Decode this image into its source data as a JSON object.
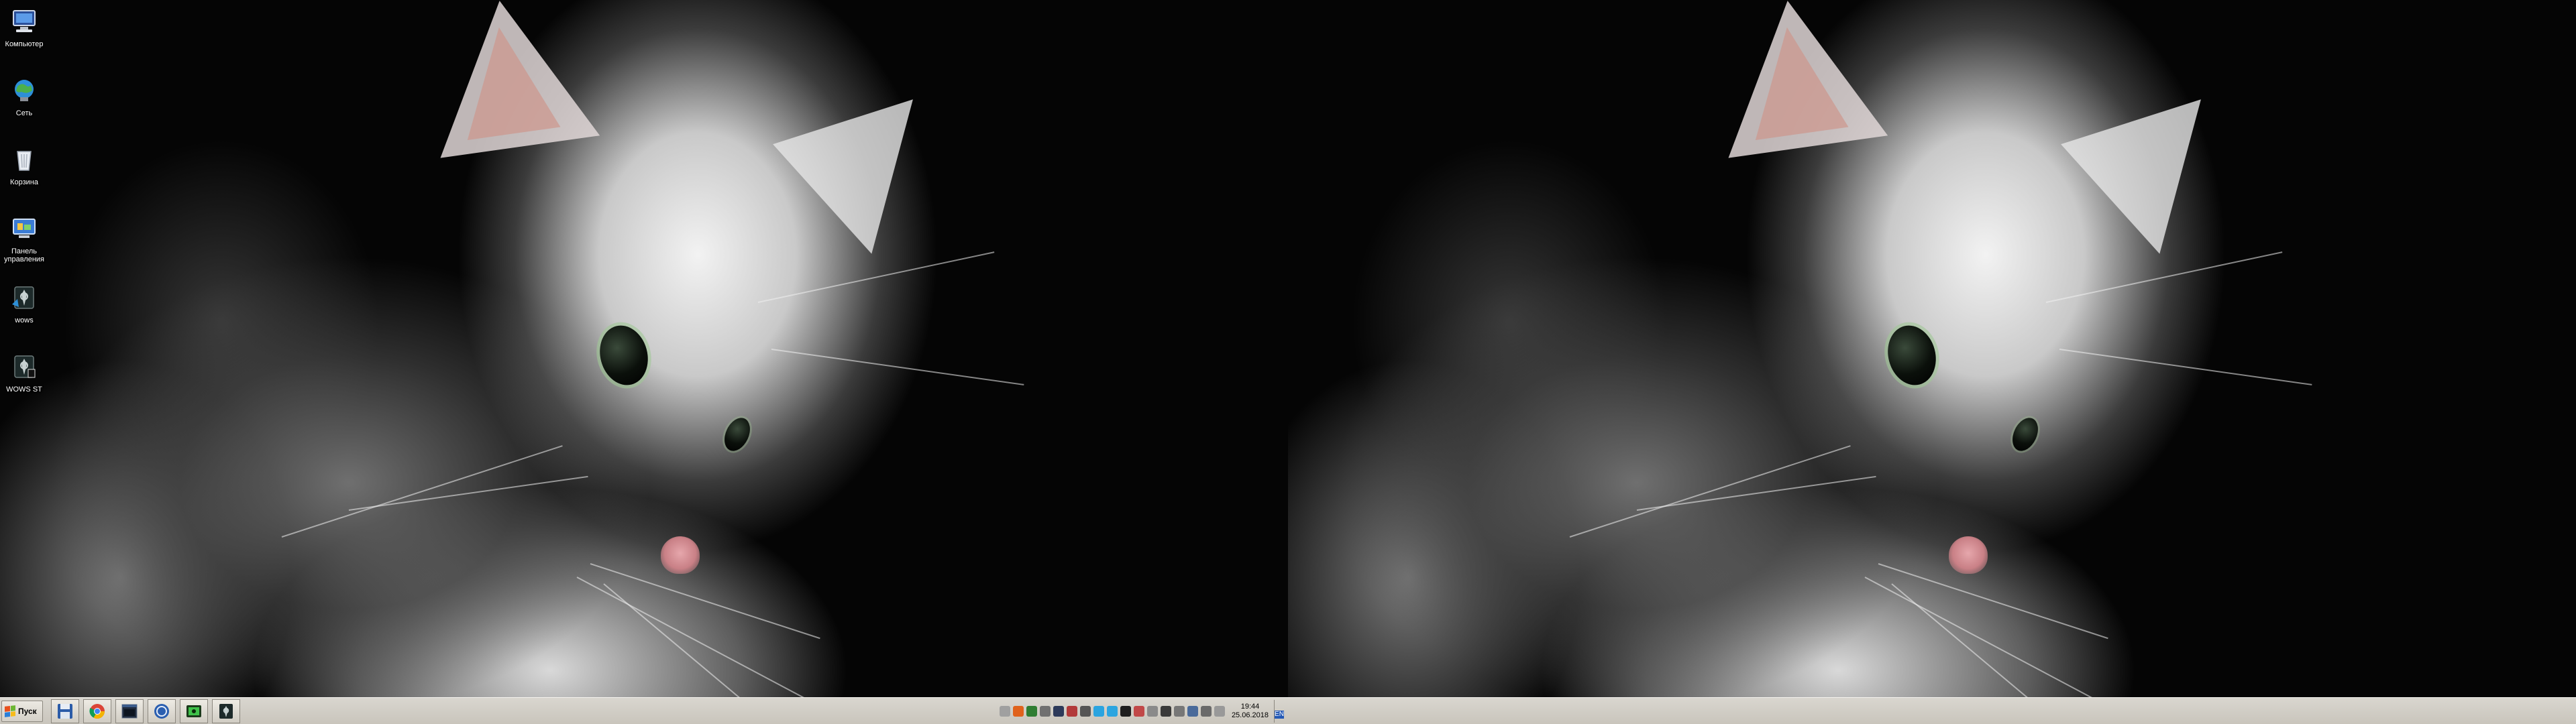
{
  "desktop_icons": [
    {
      "label": "Компьютер",
      "icon": "computer-icon"
    },
    {
      "label": "Сеть",
      "icon": "network-globe-icon"
    },
    {
      "label": "Корзина",
      "icon": "recycle-bin-icon"
    },
    {
      "label": "Панель управления",
      "icon": "control-panel-icon"
    },
    {
      "label": "wows",
      "icon": "wows-launcher-icon"
    },
    {
      "label": "WOWS ST",
      "icon": "wows-st-launcher-icon"
    }
  ],
  "taskbar": {
    "start_label": "Пуск",
    "pinned": [
      {
        "icon": "floppy-save-icon"
      },
      {
        "icon": "chrome-icon"
      },
      {
        "icon": "window-app-icon"
      },
      {
        "icon": "blue-circle-app-icon"
      },
      {
        "icon": "green-screen-app-icon"
      },
      {
        "icon": "wows-taskbar-icon"
      }
    ],
    "tray_icons": [
      {
        "icon": "tray-icon-1",
        "color": "#a0a0a0"
      },
      {
        "icon": "tray-icon-2",
        "color": "#e0621c"
      },
      {
        "icon": "tray-icon-3",
        "color": "#2f7d32"
      },
      {
        "icon": "tray-icon-4",
        "color": "#707070"
      },
      {
        "icon": "tray-icon-5",
        "color": "#2d3a5a"
      },
      {
        "icon": "tray-icon-6",
        "color": "#b23a3a"
      },
      {
        "icon": "tray-icon-7",
        "color": "#555555"
      },
      {
        "icon": "tray-icon-8",
        "color": "#2aa4e0"
      },
      {
        "icon": "telegram-icon",
        "color": "#2ca5e0"
      },
      {
        "icon": "tray-icon-10",
        "color": "#1e1e1e"
      },
      {
        "icon": "volume-icon",
        "color": "#c14848"
      },
      {
        "icon": "tray-icon-12",
        "color": "#8a8a8a"
      },
      {
        "icon": "tray-icon-13",
        "color": "#3a3a3a"
      },
      {
        "icon": "flag-icon",
        "color": "#777777"
      },
      {
        "icon": "network-icon",
        "color": "#4a6a9a"
      },
      {
        "icon": "tray-icon-16",
        "color": "#6a6a6a"
      },
      {
        "icon": "tray-icon-17",
        "color": "#999999"
      }
    ],
    "clock_time": "19:44",
    "clock_date": "25.06.2018",
    "lang": "EN"
  }
}
